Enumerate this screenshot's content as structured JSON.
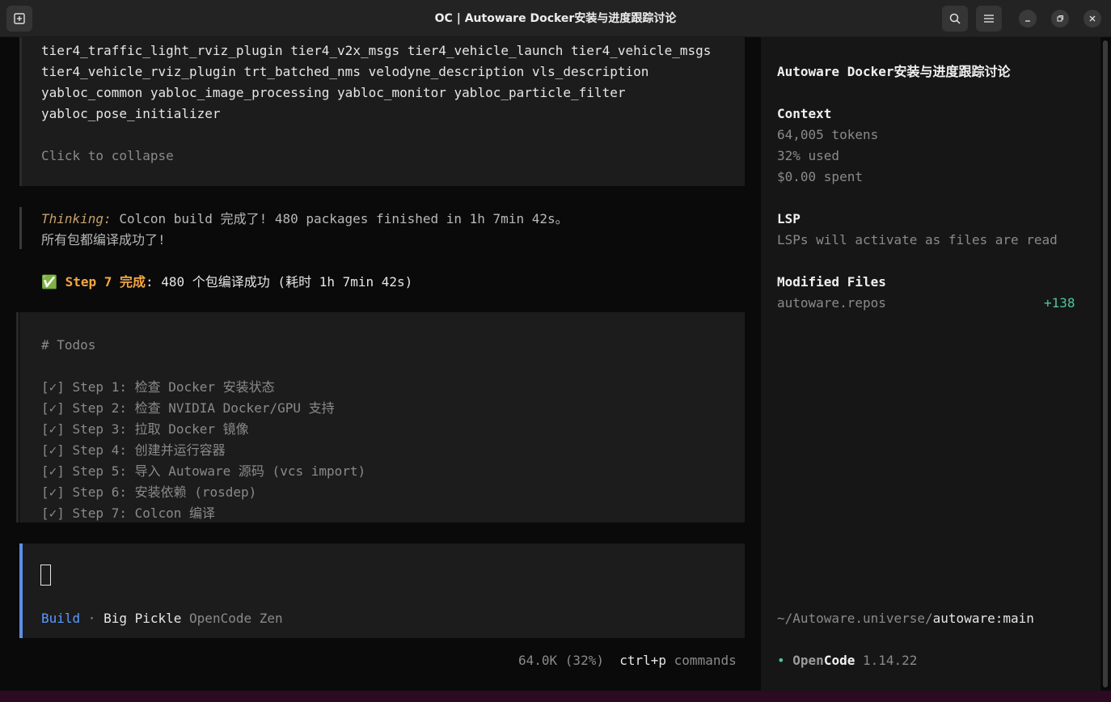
{
  "window": {
    "title": "OC | Autoware Docker安装与进度跟踪讨论"
  },
  "chat": {
    "tool_output_lines": [
      "tier4_traffic_light_rviz_plugin tier4_v2x_msgs tier4_vehicle_launch tier4_vehicle_msgs",
      "tier4_vehicle_rviz_plugin trt_batched_nms velodyne_description vls_description",
      "yabloc_common yabloc_image_processing yabloc_monitor yabloc_particle_filter",
      "yabloc_pose_initializer"
    ],
    "collapse_label": "Click to collapse",
    "thinking_label": "Thinking:",
    "thinking_text_1": " Colcon build 完成了! 480 packages finished in 1h 7min 42s。",
    "thinking_text_2": "所有包都编译成功了!",
    "step_check": "✅ ",
    "step_highlight": "Step 7 完成",
    "step_rest": ": 480 个包编译成功 (耗时 1h 7min 42s)",
    "todos_header": "# Todos",
    "todos": [
      "[✓] Step 1: 检查 Docker 安装状态",
      "[✓] Step 2: 检查 NVIDIA Docker/GPU 支持",
      "[✓] Step 3: 拉取 Docker 镜像",
      "[✓] Step 4: 创建并运行容器",
      "[✓] Step 5: 导入 Autoware 源码 (vcs import)",
      "[✓] Step 6: 安装依赖 (rosdep)",
      "[✓] Step 7: Colcon 编译"
    ]
  },
  "input": {
    "mode": "Build",
    "separator": " · ",
    "model": "Big Pickle",
    "provider": " OpenCode Zen"
  },
  "statusbar": {
    "tokens": "64.0K (32%)",
    "shortcut": "ctrl+p",
    "shortcut_label": " commands"
  },
  "sidebar": {
    "session_title": "Autoware Docker安装与进度跟踪讨论",
    "context_header": "Context",
    "context_tokens": "64,005 tokens",
    "context_used": "32% used",
    "context_spent": "$0.00 spent",
    "lsp_header": "LSP",
    "lsp_text": "LSPs will activate as files are read",
    "modified_header": "Modified Files",
    "modified_file": "autoware.repos",
    "modified_diff": "+138",
    "path_prefix": "~/Autoware.universe/",
    "path_branch": "autoware:main",
    "app_dot": "•",
    "app_name_open": "Open",
    "app_name_code": "Code",
    "app_version": " 1.14.22"
  },
  "colors": {
    "accent_blue": "#5b8fe6",
    "orange": "#f5a742",
    "green": "#4fc4a0"
  }
}
